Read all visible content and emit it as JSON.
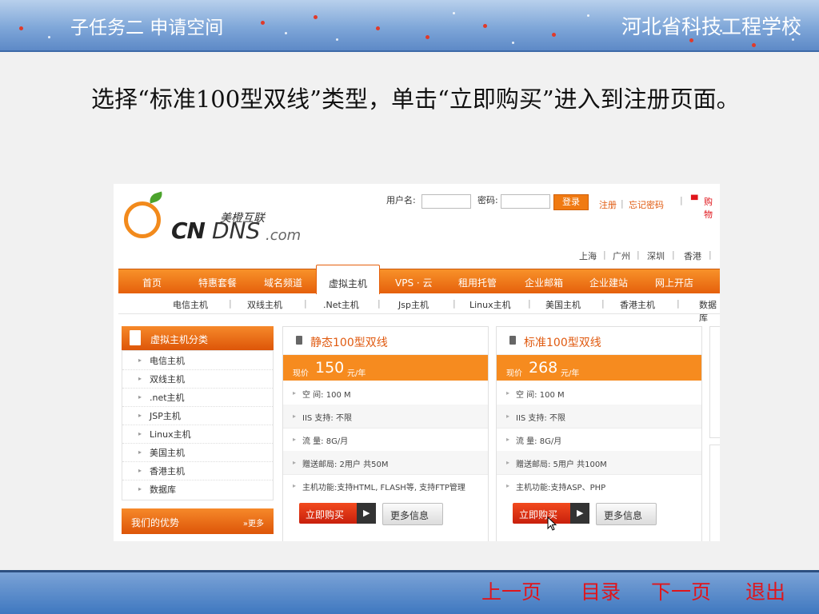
{
  "slide": {
    "title": "子任务二   申请空间",
    "school": "河北省科技工程学校",
    "body": "选择“标准100型双线”类型，单击“立即购买”进入到注册页面。"
  },
  "footer_nav": {
    "prev": "上一页",
    "toc": "目录",
    "next": "下一页",
    "exit": "退出"
  },
  "site": {
    "logo": {
      "cn_name": "美橙互联",
      "cn": "CN",
      "dns": "DNS",
      "dotcom": ".com"
    },
    "login": {
      "username_label": "用户名:",
      "password_label": "密码:",
      "login_button": "登录",
      "register": "注册",
      "divider": "|",
      "forgot": "忘记密码",
      "cart": "购物"
    },
    "cities": [
      "上海",
      "广州",
      "深圳",
      "香港"
    ],
    "nav": [
      "首页",
      "特惠套餐",
      "域名频道",
      "虚拟主机",
      "VPS · 云",
      "租用托管",
      "企业邮箱",
      "企业建站",
      "网上开店"
    ],
    "active_nav": "虚拟主机",
    "subnav": [
      "电信主机",
      "双线主机",
      ".Net主机",
      "Jsp主机",
      "Linux主机",
      "美国主机",
      "香港主机",
      "数据库"
    ],
    "sidebar": {
      "header": "虚拟主机分类",
      "items": [
        "电信主机",
        "双线主机",
        ".net主机",
        "JSP主机",
        "Linux主机",
        "美国主机",
        "香港主机",
        "数据库"
      ],
      "advantage": "我们的优势",
      "more": "»更多"
    },
    "products": [
      {
        "name": "静态100型双线",
        "price_label": "现价",
        "price": "150",
        "unit": "元/年",
        "specs": [
          "空      间: 100 M",
          "IIS 支持: 不限",
          "流      量: 8G/月",
          "赠送邮局: 2用户 共50M",
          "主机功能:支持HTML, FLASH等, 支持FTP管理"
        ],
        "buy": "立即购买",
        "more": "更多信息"
      },
      {
        "name": "标准100型双线",
        "price_label": "现价",
        "price": "268",
        "unit": "元/年",
        "specs": [
          "空      间: 100 M",
          "IIS 支持: 不限",
          "流      量: 8G/月",
          "赠送邮局: 5用户 共100M",
          "主机功能:支持ASP、PHP"
        ],
        "buy": "立即购买",
        "more": "更多信息"
      }
    ]
  },
  "colors": {
    "orange": "#f68b1f",
    "link_red": "#e0151b",
    "header_blue": "#7ea6d8"
  }
}
